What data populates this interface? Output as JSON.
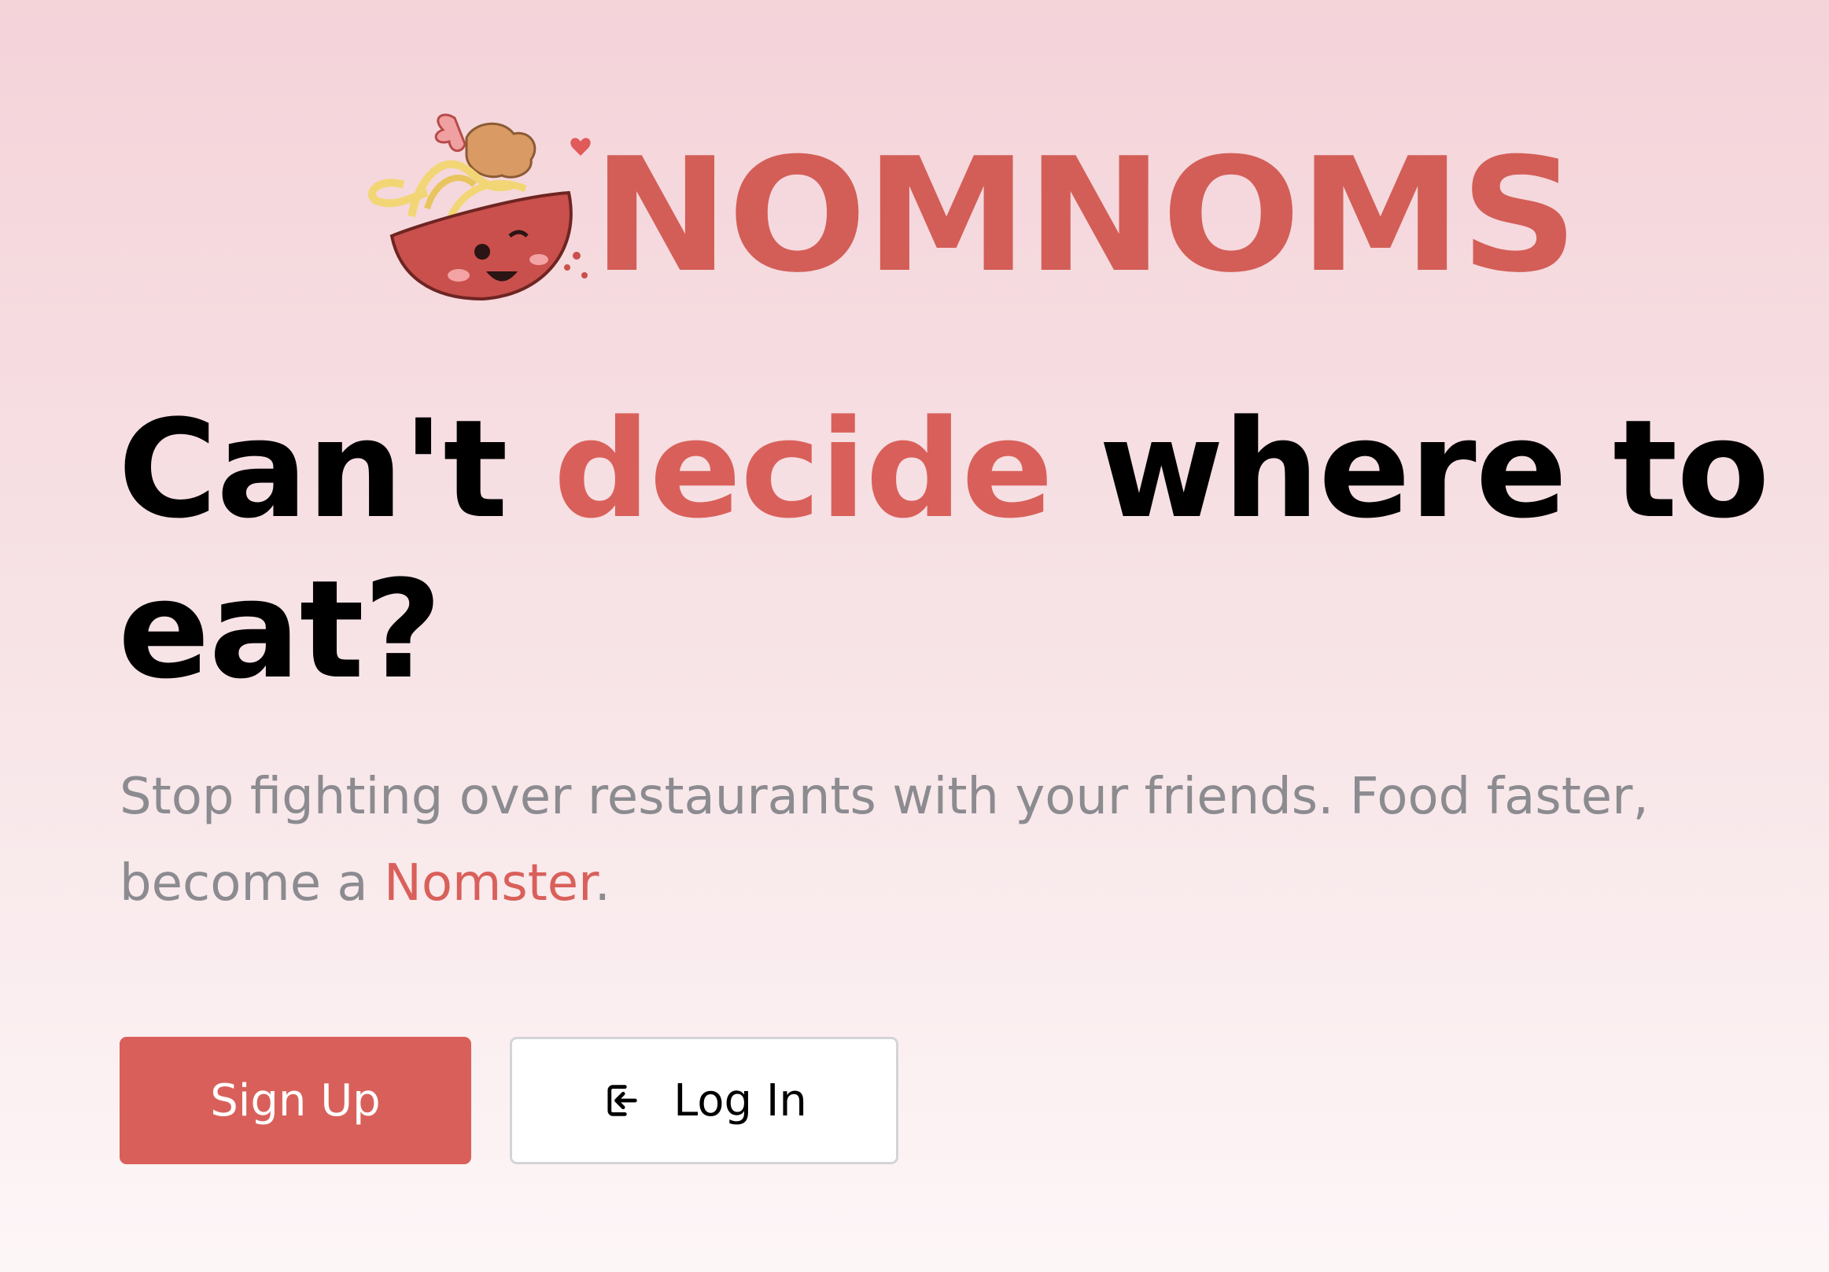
{
  "logo": {
    "wordmark": "NOMNOMS",
    "mascot": "noodle-bowl-mascot-icon"
  },
  "headline": {
    "part1": "Can't ",
    "accent": "decide",
    "part2": " where to eat?"
  },
  "subtitle": {
    "text": "Stop fighting over restaurants with your friends. Food faster, become a ",
    "accent": "Nomster",
    "end": "."
  },
  "buttons": {
    "signup_label": "Sign Up",
    "login_label": "Log In",
    "login_icon": "login-icon"
  },
  "colors": {
    "accent": "#d9605a",
    "subtitle": "#8b8b90",
    "background_top": "#f4d3d9",
    "background_bottom": "#fdf6f7"
  }
}
